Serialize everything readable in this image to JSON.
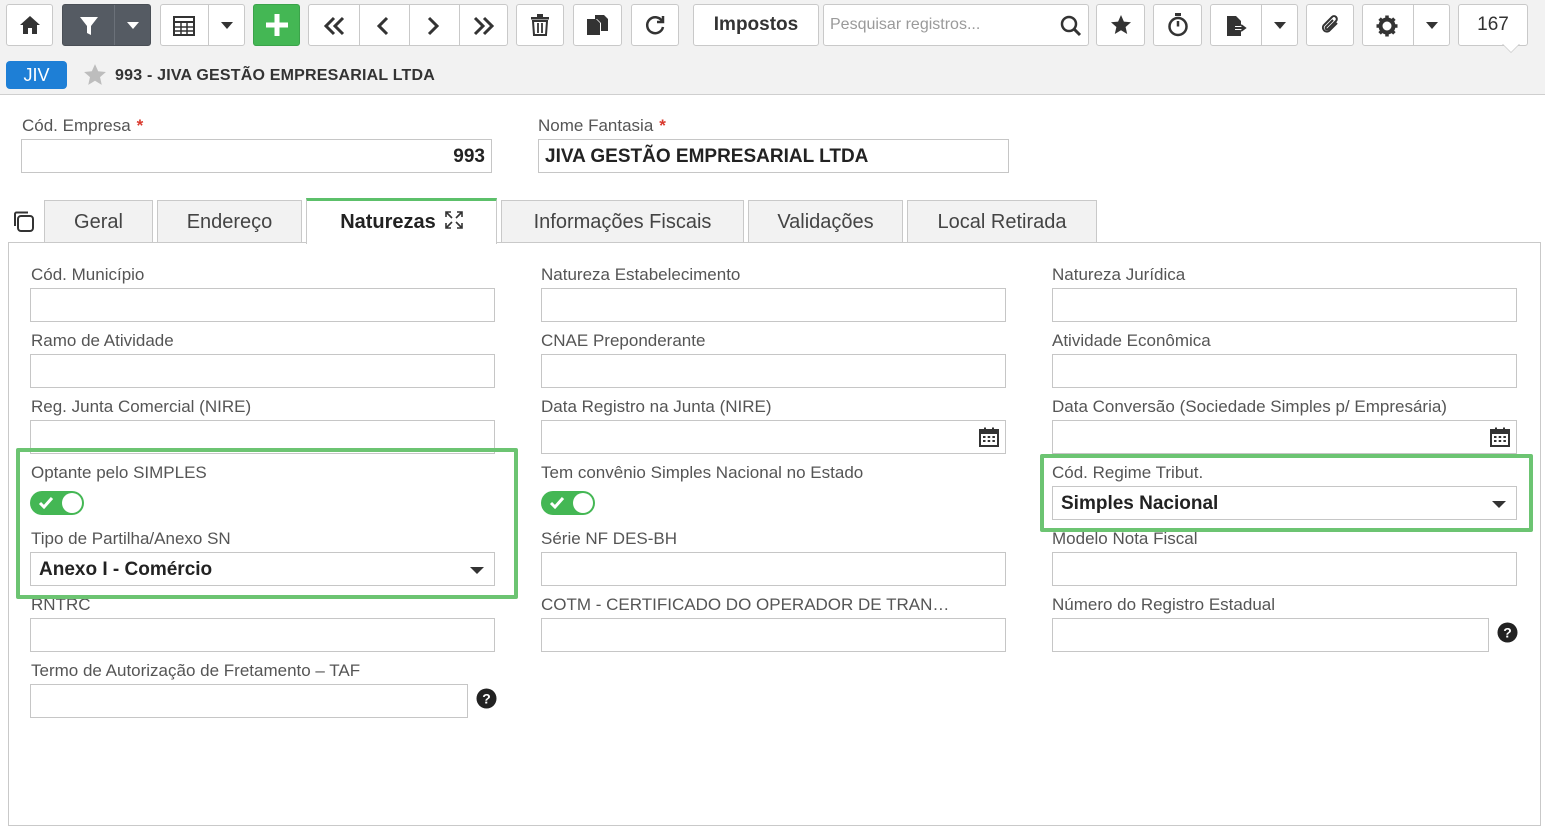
{
  "toolbar": {
    "buttons": [
      {
        "icon": "home-icon"
      },
      {
        "icon": "filter-icon"
      },
      {
        "icon": "grid-view-icon"
      },
      {
        "icon": "add-icon"
      },
      {
        "icon": "first-record-icon"
      },
      {
        "icon": "previous-record-icon"
      },
      {
        "icon": "next-record-icon"
      },
      {
        "icon": "last-record-icon"
      },
      {
        "icon": "delete-icon"
      },
      {
        "icon": "copy-icon"
      },
      {
        "icon": "refresh-icon"
      }
    ],
    "impostos_label": "Impostos",
    "search_placeholder": "Pesquisar registros...",
    "record_count": "167",
    "colors": {
      "primary_dark": "#555b63",
      "add_green": "#44b754"
    }
  },
  "record": {
    "badge": "JIV",
    "title": "993 - JIVA GESTÃO EMPRESARIAL LTDA",
    "badge_color": "#1e7fd6"
  },
  "header_fields": {
    "cod_empresa": {
      "label": "Cód. Empresa",
      "value": "993",
      "required": "*"
    },
    "nome_fantasia": {
      "label": "Nome Fantasia",
      "value": "JIVA GESTÃO EMPRESARIAL LTDA",
      "required": "*"
    }
  },
  "tabs": [
    {
      "label": "Geral"
    },
    {
      "label": "Endereço"
    },
    {
      "label": "Naturezas",
      "active": true
    },
    {
      "label": "Informações Fiscais"
    },
    {
      "label": "Validações"
    },
    {
      "label": "Local Retirada"
    }
  ],
  "naturezas": {
    "cod_municipio": {
      "label": "Cód. Município",
      "value": ""
    },
    "natureza_estabelecimento": {
      "label": "Natureza Estabelecimento",
      "value": ""
    },
    "natureza_juridica": {
      "label": "Natureza Jurídica",
      "value": ""
    },
    "ramo_atividade": {
      "label": "Ramo de Atividade",
      "value": ""
    },
    "cnae_preponderante": {
      "label": "CNAE Preponderante",
      "value": ""
    },
    "atividade_economica": {
      "label": "Atividade Econômica",
      "value": ""
    },
    "reg_junta": {
      "label": "Reg. Junta Comercial (NIRE)",
      "value": ""
    },
    "data_registro_junta": {
      "label": "Data Registro na Junta (NIRE)",
      "value": ""
    },
    "data_conversao": {
      "label": "Data Conversão (Sociedade Simples p/ Empresária)",
      "value": ""
    },
    "optante_simples": {
      "label": "Optante pelo SIMPLES",
      "checked": true
    },
    "convenio_simples": {
      "label": "Tem convênio Simples Nacional no Estado",
      "checked": true
    },
    "cod_regime_tribut": {
      "label": "Cód. Regime Tribut.",
      "value": "Simples Nacional"
    },
    "tipo_partilha": {
      "label": "Tipo de Partilha/Anexo SN",
      "value": "Anexo I - Comércio"
    },
    "serie_nf": {
      "label": "Série NF DES-BH",
      "value": ""
    },
    "modelo_nota": {
      "label": "Modelo Nota Fiscal",
      "value": ""
    },
    "rntrc": {
      "label": "RNTRC",
      "value": ""
    },
    "cotm": {
      "label": "COTM - CERTIFICADO DO OPERADOR DE TRAN…",
      "value": ""
    },
    "numero_registro_estadual": {
      "label": "Número do Registro Estadual",
      "value": ""
    },
    "termo_taf": {
      "label": "Termo de Autorização de Fretamento – TAF",
      "value": ""
    }
  },
  "colors": {
    "toggle_on": "#44b754",
    "highlight": "#6cc472",
    "required": "#d9382c",
    "active_tab": "#5cc06a"
  }
}
